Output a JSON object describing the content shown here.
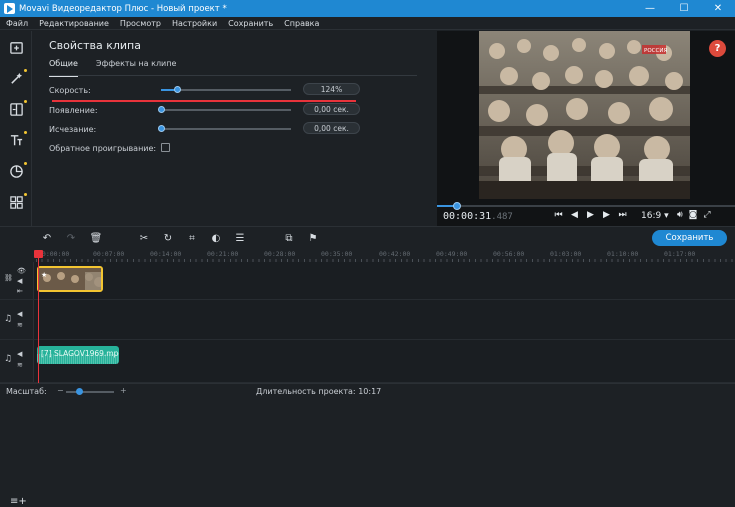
{
  "window": {
    "title": "Movavi Видеоредактор Плюс - Новый проект *",
    "minimize": "—",
    "maximize": "☐",
    "close": "✕"
  },
  "menu": [
    "Файл",
    "Редактирование",
    "Просмотр",
    "Настройки",
    "Сохранить",
    "Справка"
  ],
  "leftbar": {
    "items": [
      {
        "icon": "import-icon",
        "badge": false
      },
      {
        "icon": "magic-filters-icon",
        "badge": true
      },
      {
        "icon": "transitions-icon",
        "badge": true
      },
      {
        "icon": "titles-icon",
        "badge": true
      },
      {
        "icon": "stickers-icon",
        "badge": true
      },
      {
        "icon": "more-tools-icon",
        "badge": true
      }
    ]
  },
  "props": {
    "title": "Свойства клипа",
    "tabs": [
      "Общие",
      "Эффекты на клипе"
    ],
    "rows": [
      {
        "label": "Скорость:",
        "value": "124%",
        "level": 0.12
      },
      {
        "label": "Появление:",
        "value": "0,00 сек.",
        "level": 0
      },
      {
        "label": "Исчезание:",
        "value": "0,00 сек.",
        "level": 0
      }
    ],
    "reverse_label": "Обратное проигрывание:"
  },
  "preview": {
    "help": "?",
    "channel_badge": "РОССИЯ",
    "timecode_main": "00:00:31",
    "timecode_ms": ".487",
    "aspect": "16:9 ▾",
    "progress": 0.07
  },
  "toolbar": {
    "save_label": "Сохранить"
  },
  "ruler": {
    "labels": [
      "00:00:00",
      "00:07:00",
      "00:14:00",
      "00:21:00",
      "00:28:00",
      "00:35:00",
      "00:42:00",
      "00:49:00",
      "00:56:00",
      "01:03:00",
      "01:10:00",
      "01:17:00"
    ]
  },
  "timeline": {
    "audio_clip_name": "[7] SLAGOV1969.mpg"
  },
  "status": {
    "zoom_label": "Масштаб:",
    "minus": "−",
    "plus": "+",
    "duration_label": "Длительность проекта:",
    "duration_value": "10:17"
  },
  "colors": {
    "accent": "#1f88d2",
    "clip_selected": "#f3c531",
    "audio_clip": "#27b29a",
    "playhead": "#e8333b",
    "help": "#dd4a3c"
  }
}
